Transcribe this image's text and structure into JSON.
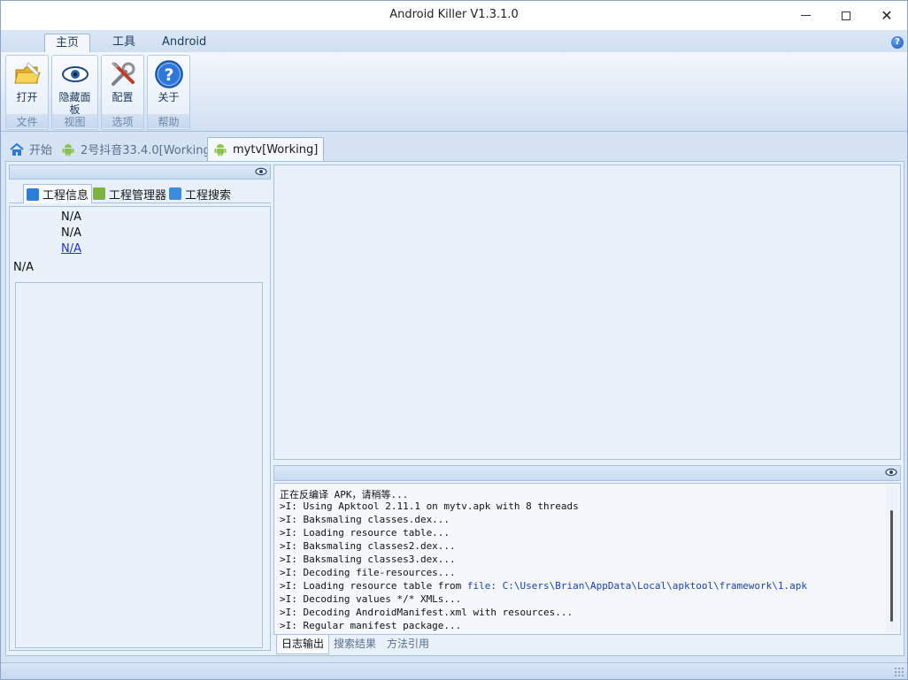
{
  "window": {
    "title": "Android Killer V1.3.1.0",
    "controls": [
      "minimize",
      "maximize",
      "close"
    ]
  },
  "ribbon": {
    "tabs": [
      {
        "label": "主页",
        "active": true
      },
      {
        "label": "工具",
        "active": false
      },
      {
        "label": "Android",
        "active": false
      }
    ],
    "help_glyph": "?",
    "groups": [
      {
        "button": "打开",
        "group": "文件",
        "icon": "open-folder-icon"
      },
      {
        "button": "隐藏面板",
        "group": "视图",
        "icon": "eye-icon"
      },
      {
        "button": "配置",
        "group": "选项",
        "icon": "tools-icon"
      },
      {
        "button": "关于",
        "group": "帮助",
        "icon": "help-icon"
      }
    ]
  },
  "doc_tabs": [
    {
      "label": "开始",
      "icon": "home-icon",
      "active": false
    },
    {
      "label": "2号抖音33.4.0[Working]",
      "icon": "android-icon",
      "active": false
    },
    {
      "label": "mytv[Working]",
      "icon": "android-icon",
      "active": true
    }
  ],
  "left_panel": {
    "subtabs": [
      {
        "label": "工程信息",
        "icon": "info-icon",
        "active": true
      },
      {
        "label": "工程管理器",
        "icon": "android-icon",
        "active": false
      },
      {
        "label": "工程搜索",
        "icon": "search-icon",
        "active": false
      }
    ],
    "info_lines": [
      "N/A",
      "N/A",
      "N/A",
      "N/A"
    ]
  },
  "log": {
    "lines": [
      "正在反编译 APK，请稍等...",
      ">I: Using Apktool 2.11.1 on mytv.apk with 8 threads",
      ">I: Baksmaling classes.dex...",
      ">I: Loading resource table...",
      ">I: Baksmaling classes2.dex...",
      ">I: Baksmaling classes3.dex...",
      ">I: Decoding file-resources...",
      ">I: Loading resource table from ",
      ">I: Decoding values */* XMLs...",
      ">I: Decoding AndroidManifest.xml with resources...",
      ">I: Regular manifest package..."
    ],
    "framework_path": "file: C:\\Users\\Brian\\AppData\\Local\\apktool\\framework\\1.apk",
    "tabs": [
      {
        "label": "日志输出",
        "active": true
      },
      {
        "label": "搜索结果",
        "active": false
      },
      {
        "label": "方法引用",
        "active": false
      }
    ]
  },
  "colors": {
    "chrome": "#d5e3f3",
    "panel": "#e9f1fa",
    "border": "#a9c0dd",
    "link": "#2034cc",
    "android_green": "#8bc34a"
  }
}
